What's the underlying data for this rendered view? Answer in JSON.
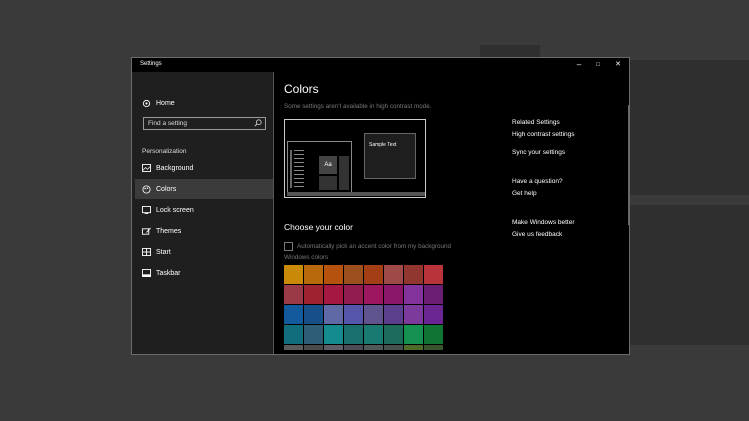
{
  "window": {
    "title": "Settings"
  },
  "titlebar": {
    "minimize": "–",
    "maximize": "□",
    "close": "✕"
  },
  "sidebar": {
    "home": "Home",
    "search_placeholder": "Find a setting",
    "section": "Personalization",
    "items": [
      {
        "label": "Background",
        "icon": "image-icon"
      },
      {
        "label": "Colors",
        "icon": "palette-icon"
      },
      {
        "label": "Lock screen",
        "icon": "lock-screen-icon"
      },
      {
        "label": "Themes",
        "icon": "brush-icon"
      },
      {
        "label": "Start",
        "icon": "start-icon"
      },
      {
        "label": "Taskbar",
        "icon": "taskbar-icon"
      }
    ]
  },
  "main": {
    "title": "Colors",
    "note": "Some settings aren't available in high contrast mode.",
    "preview": {
      "sample": "Sample Text",
      "aa": "Aa"
    },
    "choose_heading": "Choose your color",
    "auto_pick": "Automatically pick an accent color from my background",
    "windows_colors": "Windows colors",
    "swatches": [
      [
        "#c88a08",
        "#b8690c",
        "#b5520d",
        "#9c4f1f",
        "#a33e17",
        "#9d4a49",
        "#923630",
        "#b8343a"
      ],
      [
        "#9a3a46",
        "#9e2331",
        "#a51842",
        "#911c4d",
        "#9c1760",
        "#8a1769",
        "#83339c",
        "#6a1f75"
      ],
      [
        "#125a9c",
        "#175089",
        "#5f6aa5",
        "#5555a9",
        "#60538e",
        "#5b3e8c",
        "#7c3b9a",
        "#6b2593"
      ],
      [
        "#116c7e",
        "#2d5e75",
        "#138b8f",
        "#1a6f6e",
        "#187a70",
        "#1d6b5b",
        "#149150",
        "#107534"
      ],
      [
        "#5a5a5a",
        "#4a4a4a",
        "#5d5d66",
        "#4b4b55",
        "#50595a",
        "#464f4e",
        "#4f6b2a",
        "#37542a"
      ]
    ]
  },
  "related": {
    "heading": "Related Settings",
    "high_contrast": "High contrast settings",
    "sync": "Sync your settings",
    "question": "Have a question?",
    "help": "Get help",
    "better": "Make Windows better",
    "feedback": "Give us feedback"
  }
}
